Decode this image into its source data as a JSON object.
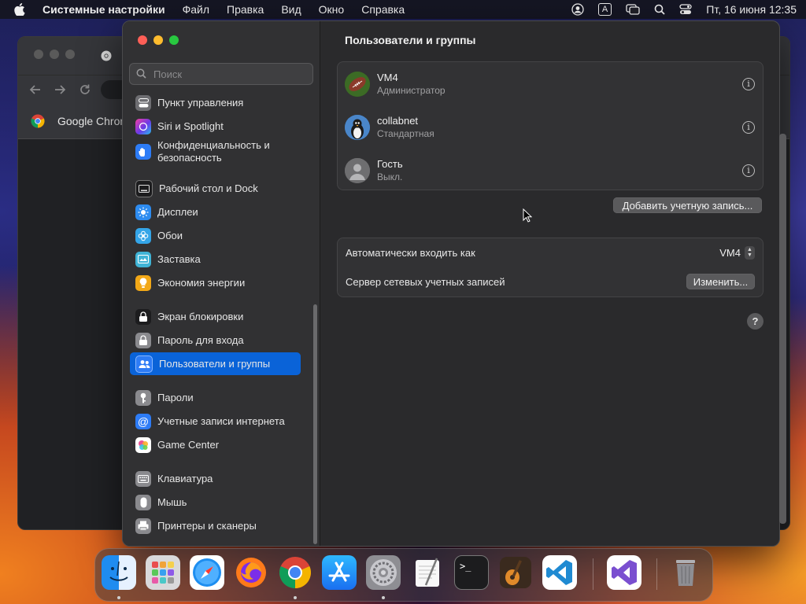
{
  "menubar": {
    "app_name": "Системные настройки",
    "items": [
      "Файл",
      "Правка",
      "Вид",
      "Окно",
      "Справка"
    ],
    "input_source": "A",
    "datetime": "Пт, 16 июня  12:35"
  },
  "chrome": {
    "bookmark": "Google Chrom"
  },
  "settings": {
    "search_placeholder": "Поиск",
    "sidebar": [
      {
        "label": "Пункт управления",
        "icon": "control-center-icon",
        "color": "#6e6e72"
      },
      {
        "label": "Siri и Spotlight",
        "icon": "siri-icon",
        "color": "#a23bd0"
      },
      {
        "label": "Конфиденциальность и безопасность",
        "icon": "hand-icon",
        "color": "#2d7cf6"
      },
      {
        "label": "Рабочий стол и Dock",
        "icon": "desktop-dock-icon",
        "color": "#1c1c1e"
      },
      {
        "label": "Дисплеи",
        "icon": "display-brightness-icon",
        "color": "#2d8cf0"
      },
      {
        "label": "Обои",
        "icon": "wallpaper-flower-icon",
        "color": "#34a5e8"
      },
      {
        "label": "Заставка",
        "icon": "screensaver-icon",
        "color": "#40b4d6"
      },
      {
        "label": "Экономия энергии",
        "icon": "bulb-icon",
        "color": "#f2a817"
      },
      {
        "label": "Экран блокировки",
        "icon": "lock-screen-icon",
        "color": "#1c1c1e"
      },
      {
        "label": "Пароль для входа",
        "icon": "lock-icon",
        "color": "#8a8a8e"
      },
      {
        "label": "Пользователи и группы",
        "icon": "users-icon",
        "color": "#2d7cf6"
      },
      {
        "label": "Пароли",
        "icon": "key-icon",
        "color": "#8a8a8e"
      },
      {
        "label": "Учетные записи интернета",
        "icon": "at-icon",
        "color": "#2d7cf6"
      },
      {
        "label": "Game Center",
        "icon": "game-center-icon",
        "color": "#e85a9a"
      },
      {
        "label": "Клавиатура",
        "icon": "keyboard-icon",
        "color": "#8a8a8e"
      },
      {
        "label": "Мышь",
        "icon": "mouse-icon",
        "color": "#8a8a8e"
      },
      {
        "label": "Принтеры и сканеры",
        "icon": "printer-icon",
        "color": "#8a8a8e"
      }
    ],
    "selected_index": 10,
    "title": "Пользователи и группы",
    "users": [
      {
        "name": "VM4",
        "role": "Администратор",
        "avatar": "football-avatar-icon"
      },
      {
        "name": "collabnet",
        "role": "Стандартная",
        "avatar": "penguin-avatar-icon"
      },
      {
        "name": "Гость",
        "role": "Выкл.",
        "avatar": "guest-avatar-icon"
      }
    ],
    "add_account_label": "Добавить учетную запись...",
    "auto_login_label": "Автоматически входить как",
    "auto_login_value": "VM4",
    "network_server_label": "Сервер сетевых учетных записей",
    "change_label": "Изменить...",
    "help_label": "?"
  },
  "dock": [
    {
      "name": "finder",
      "icon": "finder-icon"
    },
    {
      "name": "launchpad",
      "icon": "launchpad-icon"
    },
    {
      "name": "safari",
      "icon": "safari-icon"
    },
    {
      "name": "firefox",
      "icon": "firefox-icon"
    },
    {
      "name": "chrome",
      "icon": "chrome-icon"
    },
    {
      "name": "app-store",
      "icon": "app-store-icon"
    },
    {
      "name": "system-settings",
      "icon": "system-settings-icon"
    },
    {
      "name": "textedit",
      "icon": "textedit-icon"
    },
    {
      "name": "terminal",
      "icon": "terminal-icon",
      "label": ">_"
    },
    {
      "name": "garageband",
      "icon": "garageband-icon"
    },
    {
      "name": "vscode",
      "icon": "vscode-icon"
    },
    {
      "name": "visual-studio",
      "icon": "visual-studio-icon"
    },
    {
      "name": "trash",
      "icon": "trash-icon"
    }
  ]
}
